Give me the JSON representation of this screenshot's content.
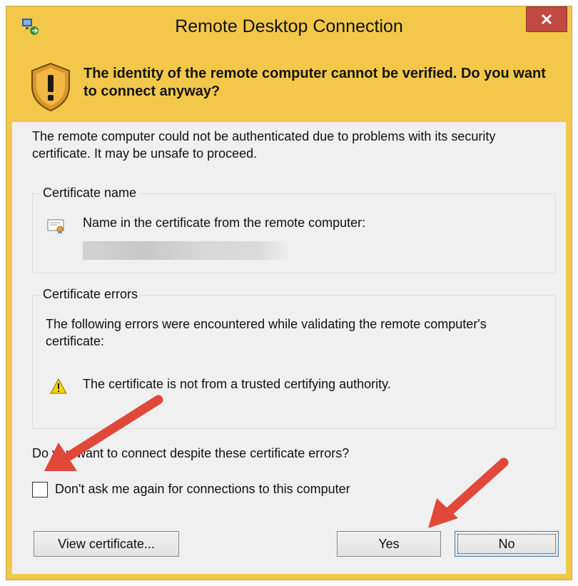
{
  "window": {
    "title": "Remote Desktop Connection"
  },
  "banner": {
    "text": "The identity of the remote computer cannot be verified. Do you want to connect anyway?"
  },
  "intro": "The remote computer could not be authenticated due to problems with its security certificate. It may be unsafe to proceed.",
  "certificate_name": {
    "title": "Certificate name",
    "label": "Name in the certificate from the remote computer:"
  },
  "certificate_errors": {
    "title": "Certificate errors",
    "description": "The following errors were encountered while validating the remote computer's certificate:",
    "error": "The certificate is not from a trusted certifying authority."
  },
  "question": "Do you want to connect despite these certificate errors?",
  "dont_ask": {
    "label": "Don't ask me again for connections to this computer",
    "checked": false
  },
  "buttons": {
    "view_certificate": "View certificate...",
    "yes": "Yes",
    "no": "No"
  },
  "colors": {
    "banner": "#f3c84a",
    "close": "#c14944",
    "arrow": "#e0483a"
  }
}
